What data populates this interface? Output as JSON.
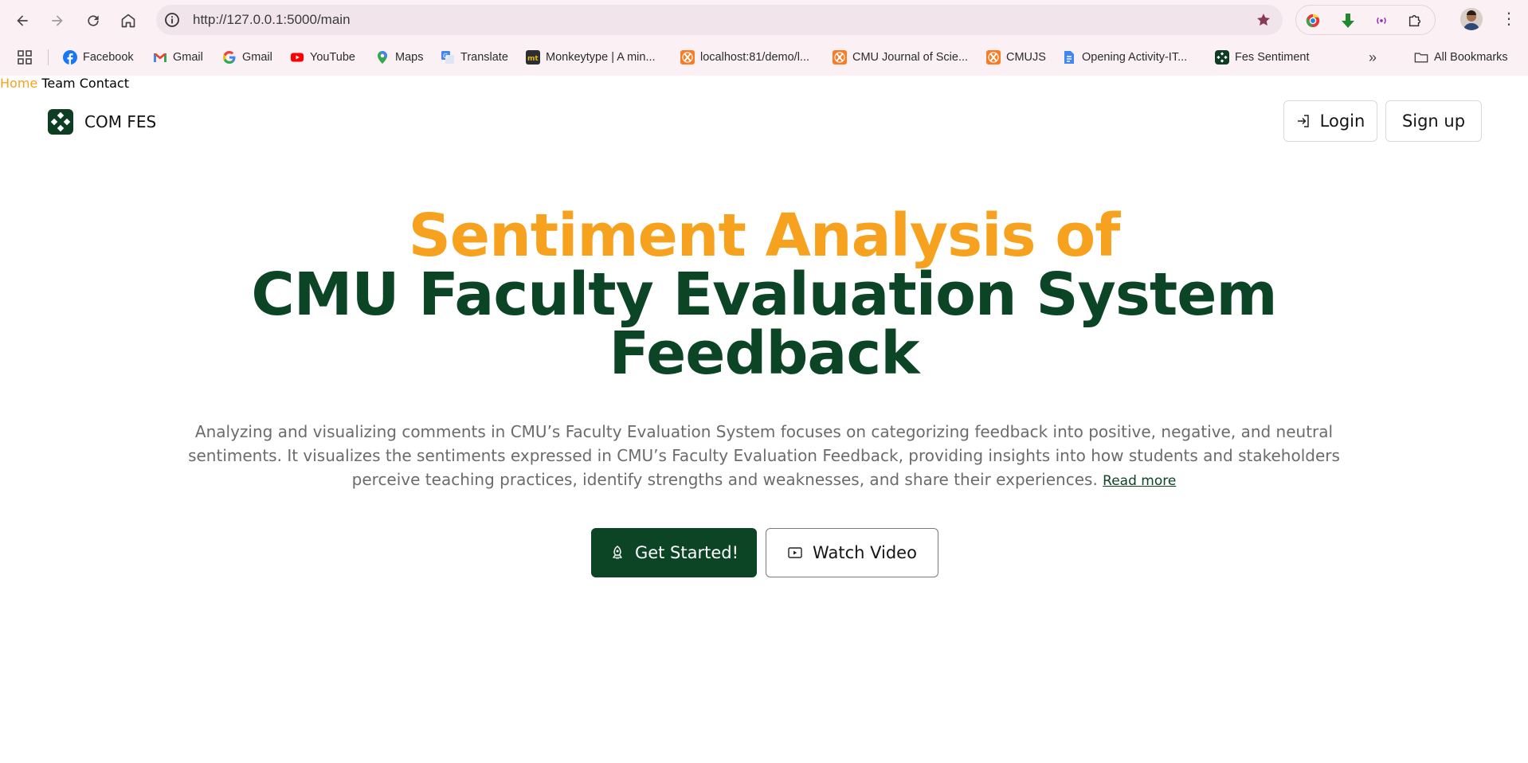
{
  "browser": {
    "url": "http://127.0.0.1:5000/main",
    "bookmarks": [
      {
        "label": "Facebook",
        "icon": "facebook-icon"
      },
      {
        "label": "Gmail",
        "icon": "gmail-icon"
      },
      {
        "label": "Gmail",
        "icon": "google-icon"
      },
      {
        "label": "YouTube",
        "icon": "youtube-icon"
      },
      {
        "label": "Maps",
        "icon": "maps-icon"
      },
      {
        "label": "Translate",
        "icon": "translate-icon"
      },
      {
        "label": "Monkeytype | A min...",
        "icon": "monkeytype-icon"
      },
      {
        "label": "localhost:81/demo/l...",
        "icon": "xampp-icon"
      },
      {
        "label": "CMU Journal of Scie...",
        "icon": "xampp-icon"
      },
      {
        "label": "CMUJS",
        "icon": "xampp-icon"
      },
      {
        "label": "Opening Activity-IT...",
        "icon": "docs-icon"
      },
      {
        "label": "Fes Sentiment",
        "icon": "fes-logo-icon"
      }
    ],
    "all_bookmarks": "All Bookmarks",
    "overflow_glyph": "»"
  },
  "site": {
    "brand": "COM FES",
    "nav": {
      "home": "Home",
      "team": "Team",
      "contact": "Contact"
    },
    "login": "Login",
    "signup": "Sign up"
  },
  "hero": {
    "title_line1": "Sentiment Analysis of",
    "title_line2": "CMU Faculty Evaluation System",
    "title_line3": "Feedback",
    "description": "Analyzing and visualizing comments in CMU’s Faculty Evaluation System focuses on categorizing feedback into positive, negative, and neutral sentiments. It visualizes the sentiments expressed in CMU’s Faculty Evaluation Feedback, providing insights into how students and stakeholders perceive teaching practices, identify strengths and weaknesses, and share their experiences.",
    "read_more": "Read more",
    "get_started": "Get Started!",
    "watch_video": "Watch Video"
  },
  "colors": {
    "accent_orange": "#f6a21e",
    "brand_green": "#0b4526",
    "nav_active": "#f6a21e"
  }
}
